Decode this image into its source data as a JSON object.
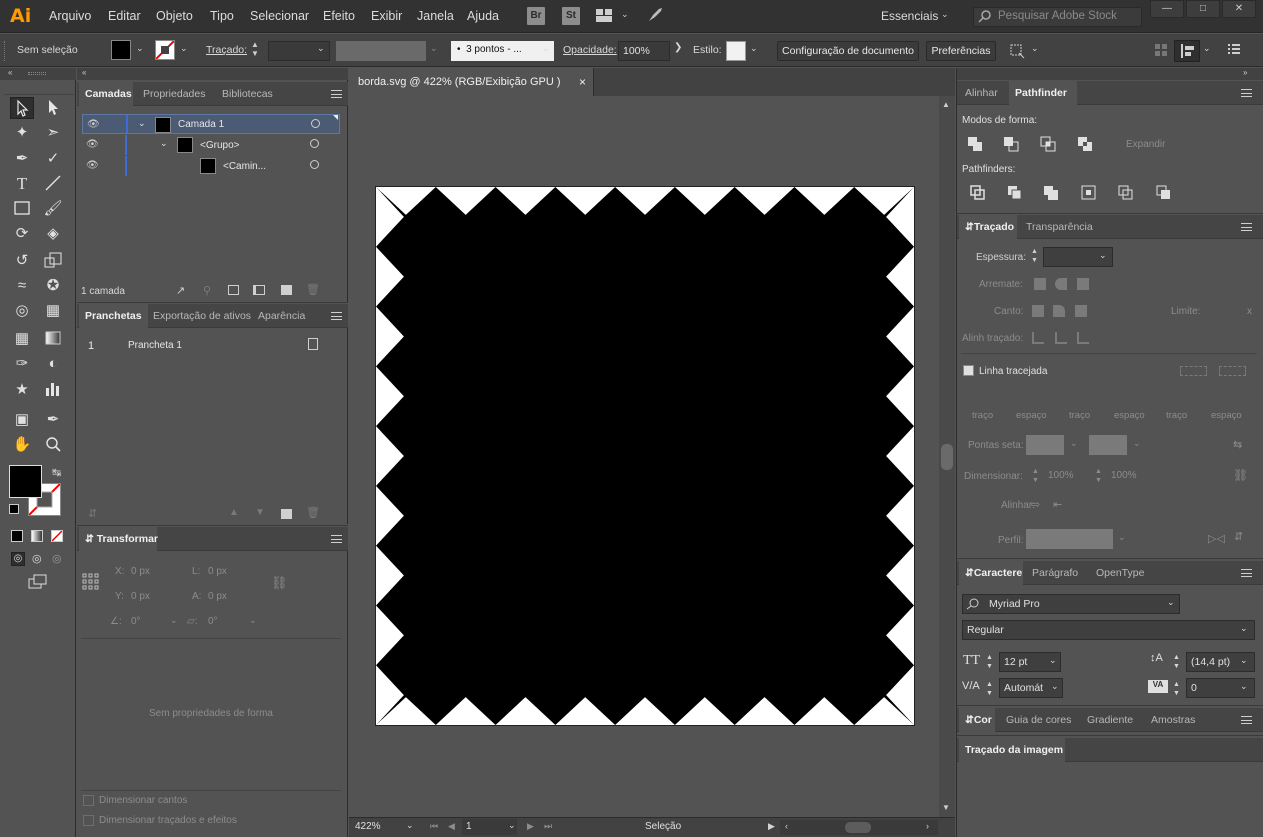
{
  "app": {
    "logo": "Ai",
    "accent": "#ff9a00"
  },
  "menu": [
    "Arquivo",
    "Editar",
    "Objeto",
    "Tipo",
    "Selecionar",
    "Efeito",
    "Exibir",
    "Janela",
    "Ajuda"
  ],
  "bridge": {
    "br": "Br",
    "st": "St"
  },
  "workspace": "Essenciais",
  "search": {
    "placeholder": "Pesquisar Adobe Stock"
  },
  "control": {
    "selection_status": "Sem seleção",
    "stroke_label": "Traçado:",
    "brush_value": "3 pontos - ...",
    "opacity_label": "Opacidade:",
    "opacity_value": "100%",
    "style_label": "Estilo:",
    "doc_setup_button": "Configuração de documento",
    "preferences_button": "Preferências"
  },
  "layers_panel": {
    "tabs": [
      "Camadas",
      "Propriedades",
      "Bibliotecas"
    ],
    "rows": [
      {
        "name": "Camada 1",
        "indent": 0
      },
      {
        "name": "<Grupo>",
        "indent": 1
      },
      {
        "name": "<Camin...",
        "indent": 2
      }
    ],
    "footer": "1 camada"
  },
  "artboards_panel": {
    "tabs": [
      "Pranchetas",
      "Exportação de ativos",
      "Aparência"
    ],
    "rows": [
      {
        "index": "1",
        "name": "Prancheta 1"
      }
    ]
  },
  "transform_panel": {
    "title": "Transformar",
    "x_label": "X:",
    "x_value": "0 px",
    "y_label": "Y:",
    "y_value": "0 px",
    "w_label": "L:",
    "w_value": "0 px",
    "h_label": "A:",
    "h_value": "0 px",
    "angle_value": "0°",
    "shear_value": "0°",
    "empty_message": "Sem propriedades de forma",
    "scale_corners": "Dimensionar cantos",
    "scale_strokes": "Dimensionar traçados e efeitos"
  },
  "document": {
    "tab_title": "borda.svg @ 422% (RGB/Exibição GPU )",
    "close_glyph": "×",
    "zoom": "422%",
    "artboard_index": "1",
    "status_tool": "Seleção"
  },
  "align_panel": {
    "tabs": [
      "Alinhar",
      "Pathfinder"
    ],
    "shape_modes_label": "Modos de forma:",
    "expand_button": "Expandir",
    "pathfinders_label": "Pathfinders:"
  },
  "stroke_panel": {
    "tabs": [
      "Traçado",
      "Transparência"
    ],
    "weight_label": "Espessura:",
    "cap_label": "Arremate:",
    "corner_label": "Canto:",
    "limit_label": "Limite:",
    "limit_x": "x",
    "align_label": "Alinh traçado:",
    "dashed_label": "Linha tracejada",
    "dash_labels": [
      "traço",
      "espaço",
      "traço",
      "espaço",
      "traço",
      "espaço"
    ],
    "arrowheads_label": "Pontas seta:",
    "scale_label": "Dimensionar:",
    "scale_value_1": "100%",
    "scale_value_2": "100%",
    "align_arrows_label": "Alinhar:",
    "profile_label": "Perfil:"
  },
  "character_panel": {
    "tabs": [
      "Caractere",
      "Parágrafo",
      "OpenType"
    ],
    "font_family": "Myriad Pro",
    "font_style": "Regular",
    "font_size": "12 pt",
    "leading": "(14,4 pt)",
    "kerning": "Automát",
    "tracking": "0"
  },
  "color_panel": {
    "tabs": [
      "Cor",
      "Guia de cores",
      "Gradiente",
      "Amostras"
    ]
  },
  "image_trace_panel": {
    "tab": "Traçado da imagem"
  }
}
